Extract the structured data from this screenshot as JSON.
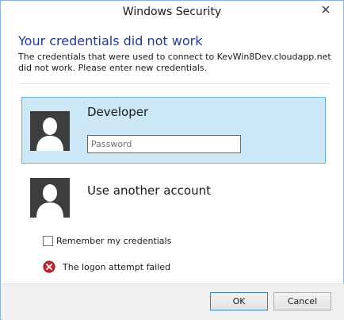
{
  "window": {
    "title": "Windows Security"
  },
  "header": {
    "heading": "Your credentials did not work",
    "description": "The credentials that were used to connect to KevWin8Dev.cloudapp.net did not work. Please enter new credentials."
  },
  "accounts": [
    {
      "name": "Developer",
      "selected": true,
      "password_value": "",
      "password_placeholder": "Password"
    },
    {
      "name": "Use another account",
      "selected": false
    }
  ],
  "remember": {
    "label": "Remember my credentials",
    "checked": false
  },
  "error": {
    "message": "The logon attempt failed",
    "icon": "error-icon"
  },
  "buttons": {
    "ok": "OK",
    "cancel": "Cancel"
  },
  "colors": {
    "heading": "#1e3a96",
    "selected_tile": "#cce8f7",
    "selected_border": "#6aaee0",
    "error_red": "#c0272d"
  }
}
